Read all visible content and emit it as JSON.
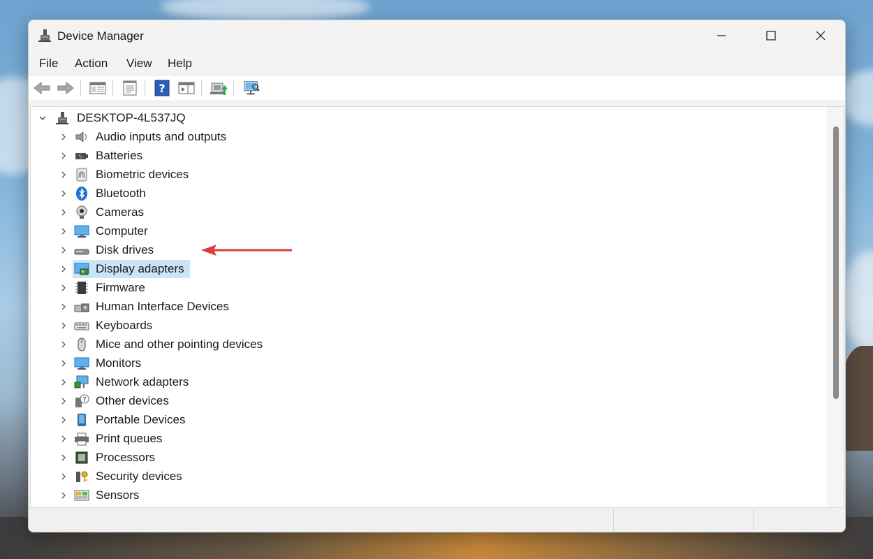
{
  "window": {
    "title": "Device Manager"
  },
  "menu": [
    "File",
    "Action",
    "View",
    "Help"
  ],
  "toolbar": {
    "buttons": [
      "back-icon",
      "forward-icon",
      "show-hide-console-tree-icon",
      "properties-icon",
      "help-icon",
      "action-pane-icon",
      "update-driver-icon",
      "scan-hardware-icon"
    ]
  },
  "tree": {
    "root": "DESKTOP-4L537JQ",
    "items": [
      {
        "label": "Audio inputs and outputs",
        "icon": "speaker-icon"
      },
      {
        "label": "Batteries",
        "icon": "battery-icon"
      },
      {
        "label": "Biometric devices",
        "icon": "fingerprint-icon"
      },
      {
        "label": "Bluetooth",
        "icon": "bluetooth-icon"
      },
      {
        "label": "Cameras",
        "icon": "camera-icon"
      },
      {
        "label": "Computer",
        "icon": "computer-icon"
      },
      {
        "label": "Disk drives",
        "icon": "disk-drive-icon"
      },
      {
        "label": "Display adapters",
        "icon": "display-adapter-icon"
      },
      {
        "label": "Firmware",
        "icon": "firmware-chip-icon"
      },
      {
        "label": "Human Interface Devices",
        "icon": "hid-icon"
      },
      {
        "label": "Keyboards",
        "icon": "keyboard-icon"
      },
      {
        "label": "Mice and other pointing devices",
        "icon": "mouse-icon"
      },
      {
        "label": "Monitors",
        "icon": "monitor-icon"
      },
      {
        "label": "Network adapters",
        "icon": "network-adapter-icon"
      },
      {
        "label": "Other devices",
        "icon": "unknown-device-icon"
      },
      {
        "label": "Portable Devices",
        "icon": "portable-device-icon"
      },
      {
        "label": "Print queues",
        "icon": "printer-icon"
      },
      {
        "label": "Processors",
        "icon": "processor-icon"
      },
      {
        "label": "Security devices",
        "icon": "security-device-icon"
      },
      {
        "label": "Sensors",
        "icon": "sensor-icon"
      }
    ],
    "selected_index": 7
  },
  "colors": {
    "selection": "#cce4f7",
    "annotation_arrow": "#e03a3a"
  }
}
